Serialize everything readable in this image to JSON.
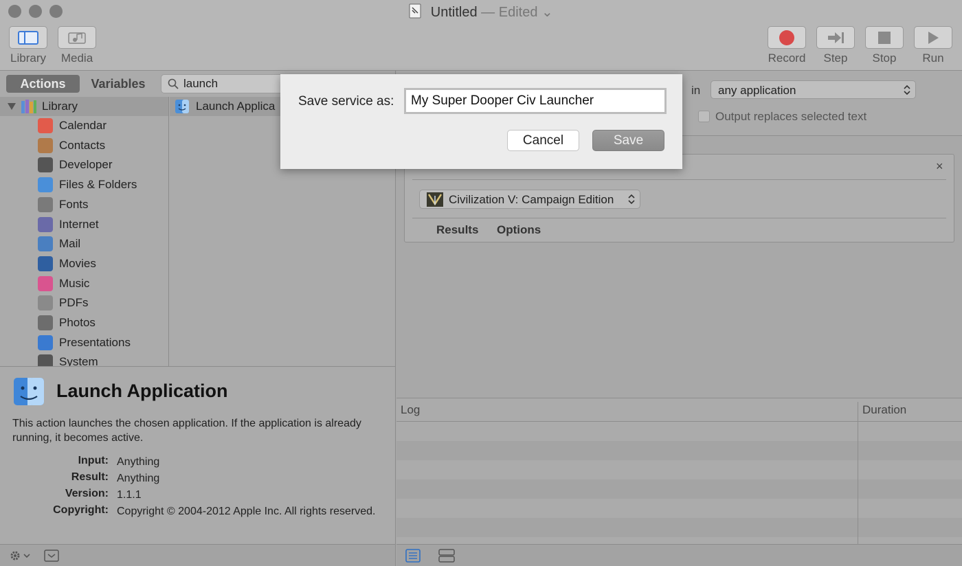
{
  "window": {
    "title": "Untitled",
    "title_suffix": "— Edited"
  },
  "toolbar": {
    "library_label": "Library",
    "media_label": "Media",
    "record_label": "Record",
    "step_label": "Step",
    "stop_label": "Stop",
    "run_label": "Run"
  },
  "sidebar": {
    "actions_tab": "Actions",
    "variables_tab": "Variables",
    "search_value": "launch",
    "root_label": "Library",
    "items": [
      {
        "label": "Calendar",
        "icon": "calendar-icon",
        "color": "#e25b4b"
      },
      {
        "label": "Contacts",
        "icon": "contacts-icon",
        "color": "#b07a4a"
      },
      {
        "label": "Developer",
        "icon": "tools-icon",
        "color": "#555555"
      },
      {
        "label": "Files & Folders",
        "icon": "finder-icon",
        "color": "#4a8fd9"
      },
      {
        "label": "Fonts",
        "icon": "fonts-icon",
        "color": "#7a7a7a"
      },
      {
        "label": "Internet",
        "icon": "globe-icon",
        "color": "#6a6aa8"
      },
      {
        "label": "Mail",
        "icon": "mail-icon",
        "color": "#4a7fc0"
      },
      {
        "label": "Movies",
        "icon": "quicktime-icon",
        "color": "#2f5fa0"
      },
      {
        "label": "Music",
        "icon": "music-icon",
        "color": "#d9548f"
      },
      {
        "label": "PDFs",
        "icon": "pdf-icon",
        "color": "#8a8a8a"
      },
      {
        "label": "Photos",
        "icon": "photos-icon",
        "color": "#6d6d6d"
      },
      {
        "label": "Presentations",
        "icon": "keynote-icon",
        "color": "#3a7ad0"
      },
      {
        "label": "System",
        "icon": "system-icon",
        "color": "#555555"
      }
    ]
  },
  "action_list": {
    "items": [
      {
        "label": "Launch Applica"
      }
    ]
  },
  "description": {
    "title": "Launch Application",
    "text": "This action launches the chosen application. If the application is already running, it becomes active.",
    "input_key": "Input:",
    "input_val": "Anything",
    "result_key": "Result:",
    "result_val": "Anything",
    "version_key": "Version:",
    "version_val": "1.1.1",
    "copyright_key": "Copyright:",
    "copyright_val": "Copyright © 2004-2012 Apple Inc.  All rights reserved."
  },
  "workflow": {
    "in_label": "in",
    "app_select": "any application",
    "output_replaces": "Output replaces selected text",
    "action_app": "Civilization V: Campaign Edition",
    "results_tab": "Results",
    "options_tab": "Options",
    "close_glyph": "×"
  },
  "log": {
    "log_col": "Log",
    "duration_col": "Duration"
  },
  "dialog": {
    "label": "Save service as:",
    "value": "My Super Dooper Civ Launcher",
    "cancel": "Cancel",
    "save": "Save"
  },
  "colors": {
    "record_red": "#d94a4a",
    "dialog_bg": "#ececec",
    "accent_blue": "#2e6fc4"
  }
}
